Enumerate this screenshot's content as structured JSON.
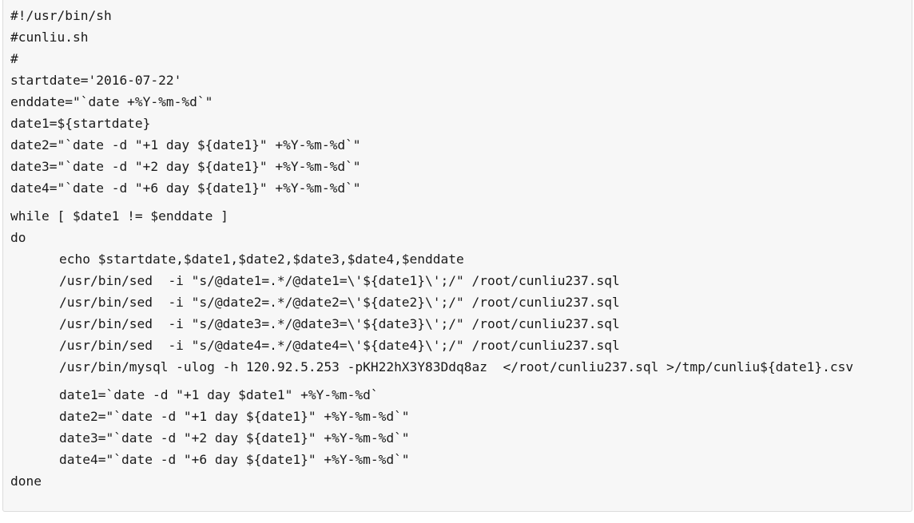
{
  "code": {
    "lines": [
      "#!/usr/bin/sh",
      "#cunliu.sh",
      "#",
      "startdate='2016-07-22'",
      "enddate=\"`date +%Y-%m-%d`\"",
      "date1=${startdate}",
      "date2=\"`date -d \"+1 day ${date1}\" +%Y-%m-%d`\"",
      "date3=\"`date -d \"+2 day ${date1}\" +%Y-%m-%d`\"",
      "date4=\"`date -d \"+6 day ${date1}\" +%Y-%m-%d`\"",
      "while [ $date1 != $enddate ]",
      "do",
      "echo $startdate,$date1,$date2,$date3,$date4,$enddate",
      "/usr/bin/sed  -i \"s/@date1=.*/@date1=\\'${date1}\\';/\" /root/cunliu237.sql",
      "/usr/bin/sed  -i \"s/@date2=.*/@date2=\\'${date2}\\';/\" /root/cunliu237.sql",
      "/usr/bin/sed  -i \"s/@date3=.*/@date3=\\'${date3}\\';/\" /root/cunliu237.sql",
      "/usr/bin/sed  -i \"s/@date4=.*/@date4=\\'${date4}\\';/\" /root/cunliu237.sql",
      "/usr/bin/mysql -ulog -h 120.92.5.253 -pKH22hX3Y83Ddq8az  </root/cunliu237.sql >/tmp/cunliu${date1}.csv",
      "date1=`date -d \"+1 day $date1\" +%Y-%m-%d`",
      "date2=\"`date -d \"+1 day ${date1}\" +%Y-%m-%d`\"",
      "date3=\"`date -d \"+2 day ${date1}\" +%Y-%m-%d`\"",
      "date4=\"`date -d \"+6 day ${date1}\" +%Y-%m-%d`\"",
      "done"
    ]
  }
}
